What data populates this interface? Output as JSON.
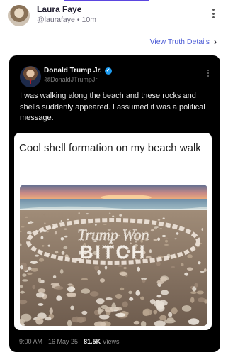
{
  "post": {
    "author_name": "Laura Faye",
    "author_handle": "@laurafaye",
    "separator": "•",
    "time": "10m",
    "details_link": "View Truth Details",
    "details_chevron": "›"
  },
  "embed": {
    "name": "Donald Trump Jr.",
    "verified_mark": "✓",
    "handle": "@DonaldJTrumpJr",
    "text": "I was walking along the beach and these rocks and shells suddenly appeared. I assumed it was a political message.",
    "card_caption": "Cool shell formation on my beach walk",
    "photo_text_line1": "Trump Won",
    "photo_text_line2": "BITCH",
    "timestamp": "9:00 AM · 16 May 25 ·",
    "views_count": "81.5K",
    "views_label": "Views"
  },
  "icons": {
    "more": "vertical-ellipsis-icon",
    "verified": "verified-badge-icon",
    "chevron": "chevron-right-icon"
  },
  "colors": {
    "link": "#4b5bd6",
    "embed_bg": "#000000",
    "verified": "#1d9bf0",
    "accent_bar": "#5b46e0"
  }
}
